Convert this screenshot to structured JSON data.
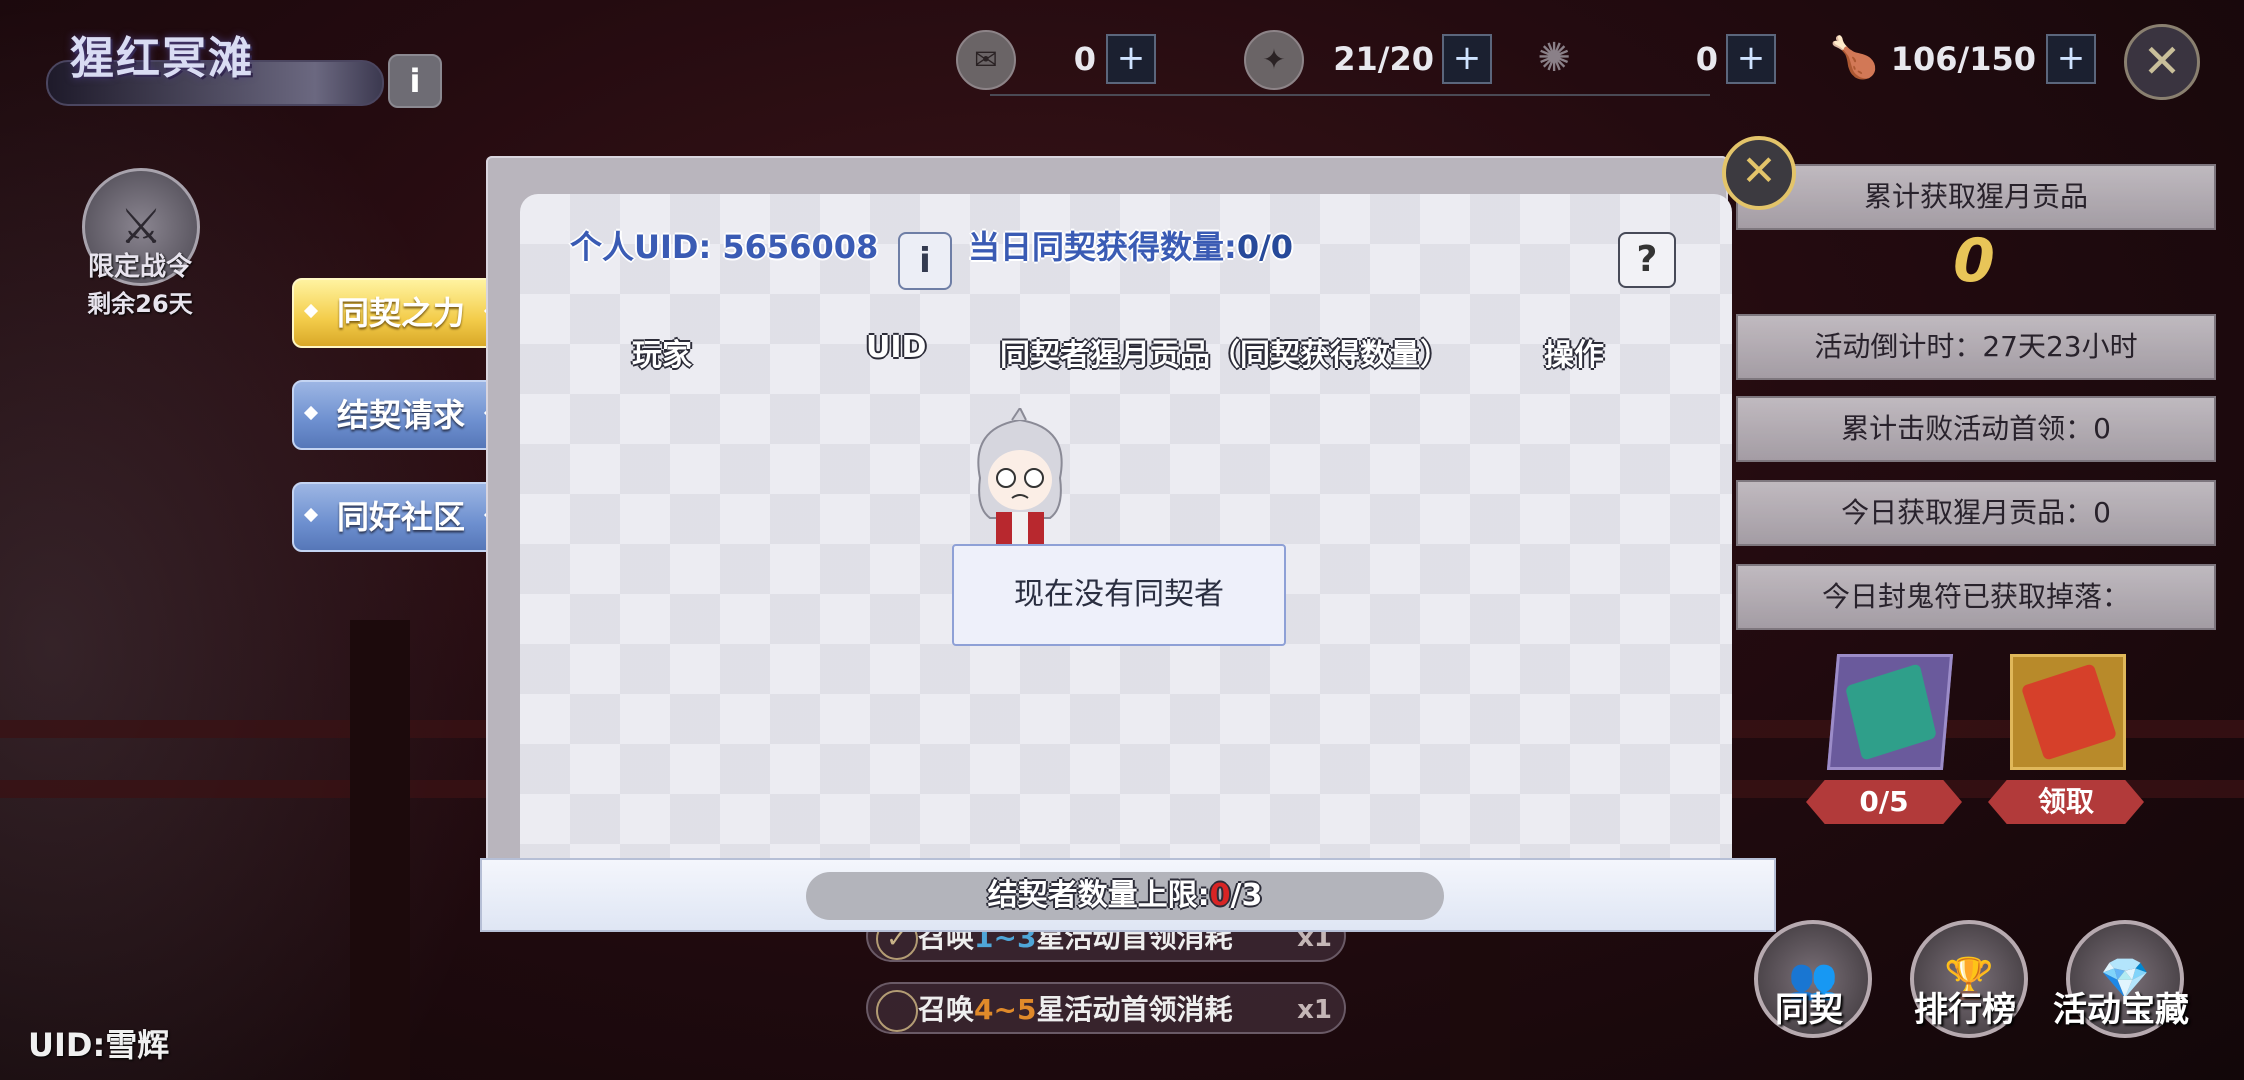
{
  "stage": {
    "title": "猩红冥滩",
    "info_glyph": "i"
  },
  "resources": [
    {
      "icon": "ticket-icon",
      "value": "0"
    },
    {
      "icon": "token-icon",
      "value": "21/20"
    },
    {
      "icon": "crab-icon",
      "value": "0"
    },
    {
      "icon": "drumstick-icon",
      "value": "106/150"
    }
  ],
  "plus_glyph": "+",
  "close_glyph": "✕",
  "battle_pass": {
    "label": "限定战令",
    "remaining": "剩余26天"
  },
  "side_tabs": [
    {
      "label": "同契之力",
      "active": true
    },
    {
      "label": "结契请求",
      "active": false
    },
    {
      "label": "同好社区",
      "active": false
    }
  ],
  "bottom_uid": "UID:雪辉",
  "right_panel": {
    "cumulative_title": "累计获取猩月贡品",
    "cumulative_value": "0",
    "countdown": "活动倒计时：27天23小时",
    "bosses_defeated": "累计击败活动首领：0",
    "today_tribute": "今日获取猩月贡品：0",
    "today_drops": "今日封鬼符已获取掉落：",
    "talismans": [
      {
        "pill": "0/5"
      },
      {
        "pill": "领取"
      }
    ]
  },
  "bottom_buttons": [
    {
      "label": "同契",
      "icon": "people-icon"
    },
    {
      "label": "排行榜",
      "icon": "trophy-icon"
    },
    {
      "label": "活动宝藏",
      "icon": "treasure-icon"
    }
  ],
  "summon_strips": [
    {
      "prefix": "召唤",
      "range": "1~3",
      "suffix": "星活动首领消耗",
      "count": "x1"
    },
    {
      "prefix": "召唤",
      "range": "4~5",
      "suffix": "星活动首领消耗",
      "count": "x1"
    }
  ],
  "dialog": {
    "uid_label": "个人UID: 5656008",
    "daily_label": "当日同契获得数量:",
    "daily_value": "0/0",
    "help_glyph": "?",
    "columns": [
      "玩家",
      "UID",
      "同契者猩月贡品（同契获得数量）",
      "操作"
    ],
    "empty_text": "现在没有同契者",
    "footer_prefix": "结契者数量上限:",
    "footer_current": "0",
    "footer_max": "/3"
  },
  "colors": {
    "accent_gold": "#e3c46a",
    "uid_blue": "#3a5bb4",
    "tab_active": "#f3cc4a",
    "tab_inactive": "#6d8fcf",
    "limit_red": "#d82424"
  }
}
